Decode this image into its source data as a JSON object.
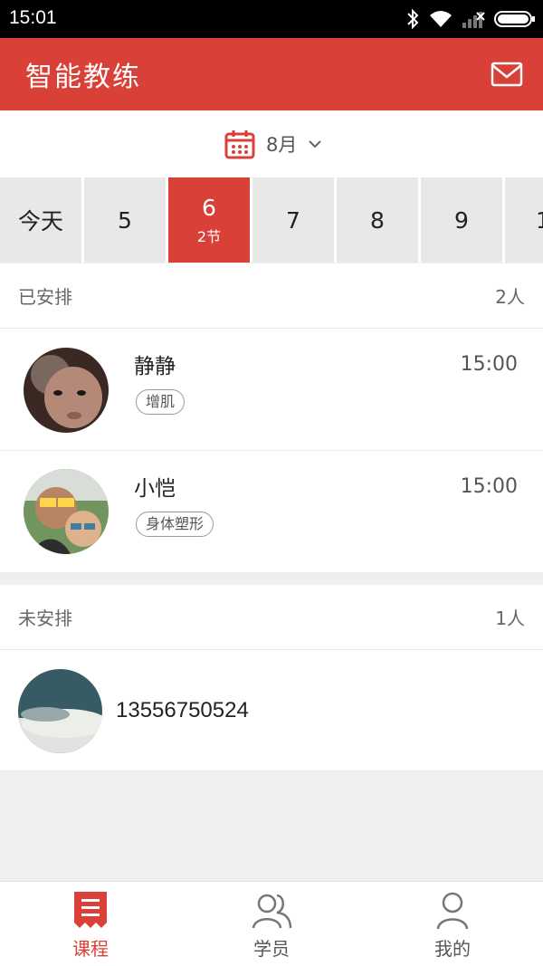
{
  "status_bar": {
    "time": "15:01"
  },
  "app_bar": {
    "title": "智能教练"
  },
  "month_selector": {
    "label": "8月"
  },
  "days": [
    {
      "label": "今天",
      "count": ""
    },
    {
      "label": "5",
      "count": ""
    },
    {
      "label": "6",
      "count": "2节"
    },
    {
      "label": "7",
      "count": ""
    },
    {
      "label": "8",
      "count": ""
    },
    {
      "label": "9",
      "count": ""
    },
    {
      "label": "1",
      "count": ""
    }
  ],
  "scheduled": {
    "label": "已安排",
    "count": "2人",
    "items": [
      {
        "name": "静静",
        "time": "15:00",
        "tag": "增肌"
      },
      {
        "name": "小恺",
        "time": "15:00",
        "tag": "身体塑形"
      }
    ]
  },
  "unscheduled": {
    "label": "未安排",
    "count": "1人",
    "items": [
      {
        "name": "13556750524"
      }
    ]
  },
  "tabs": [
    {
      "label": "课程",
      "icon": "course-icon",
      "active": true
    },
    {
      "label": "学员",
      "icon": "students-icon",
      "active": false
    },
    {
      "label": "我的",
      "icon": "profile-icon",
      "active": false
    }
  ],
  "colors": {
    "accent": "#d84038",
    "background": "#efefef",
    "selected_day": "#d84038"
  }
}
